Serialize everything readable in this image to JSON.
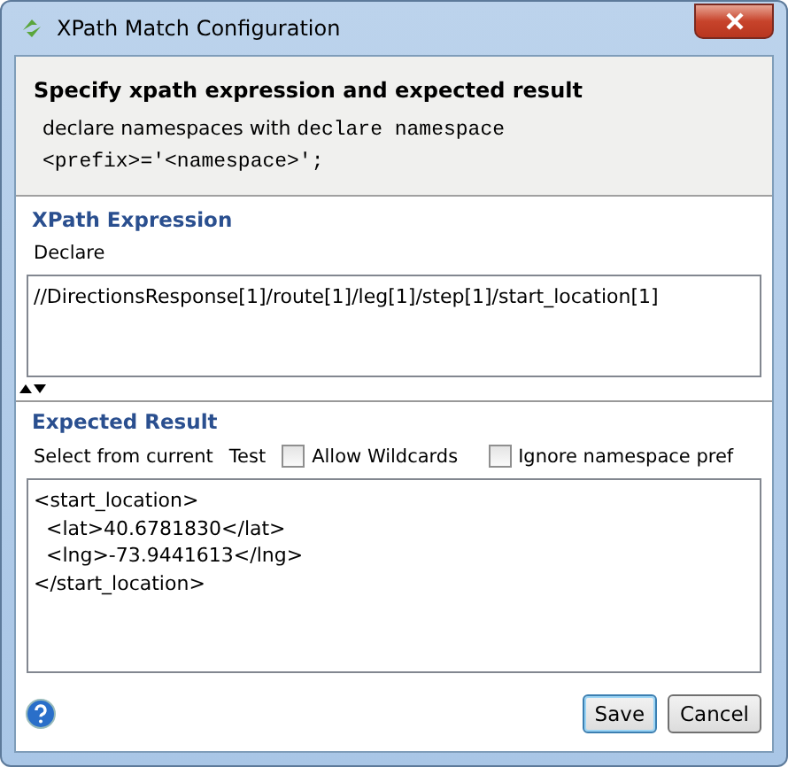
{
  "window": {
    "title": "XPath Match Configuration"
  },
  "header": {
    "title": "Specify xpath expression and expected result",
    "description": "declare namespaces with",
    "description_code": "declare namespace <prefix>='<namespace>';"
  },
  "xpath_section": {
    "title": "XPath Expression",
    "toolbar": [
      "Declare"
    ],
    "expression": "//DirectionsResponse[1]/route[1]/leg[1]/step[1]/start_location[1]"
  },
  "result_section": {
    "title": "Expected Result",
    "toolbar": [
      "Select from current",
      "Test"
    ],
    "options": [
      {
        "label": "Allow Wildcards",
        "checked": false
      },
      {
        "label": "Ignore namespace pref",
        "checked": false
      }
    ],
    "lines": [
      "<start_location>",
      "  <lat>40.6781830</lat>",
      "  <lng>-73.9441613</lng>",
      "</start_location>"
    ]
  },
  "buttons": [
    {
      "label": "Save",
      "selected": true
    },
    {
      "label": "Cancel",
      "selected": false
    }
  ]
}
